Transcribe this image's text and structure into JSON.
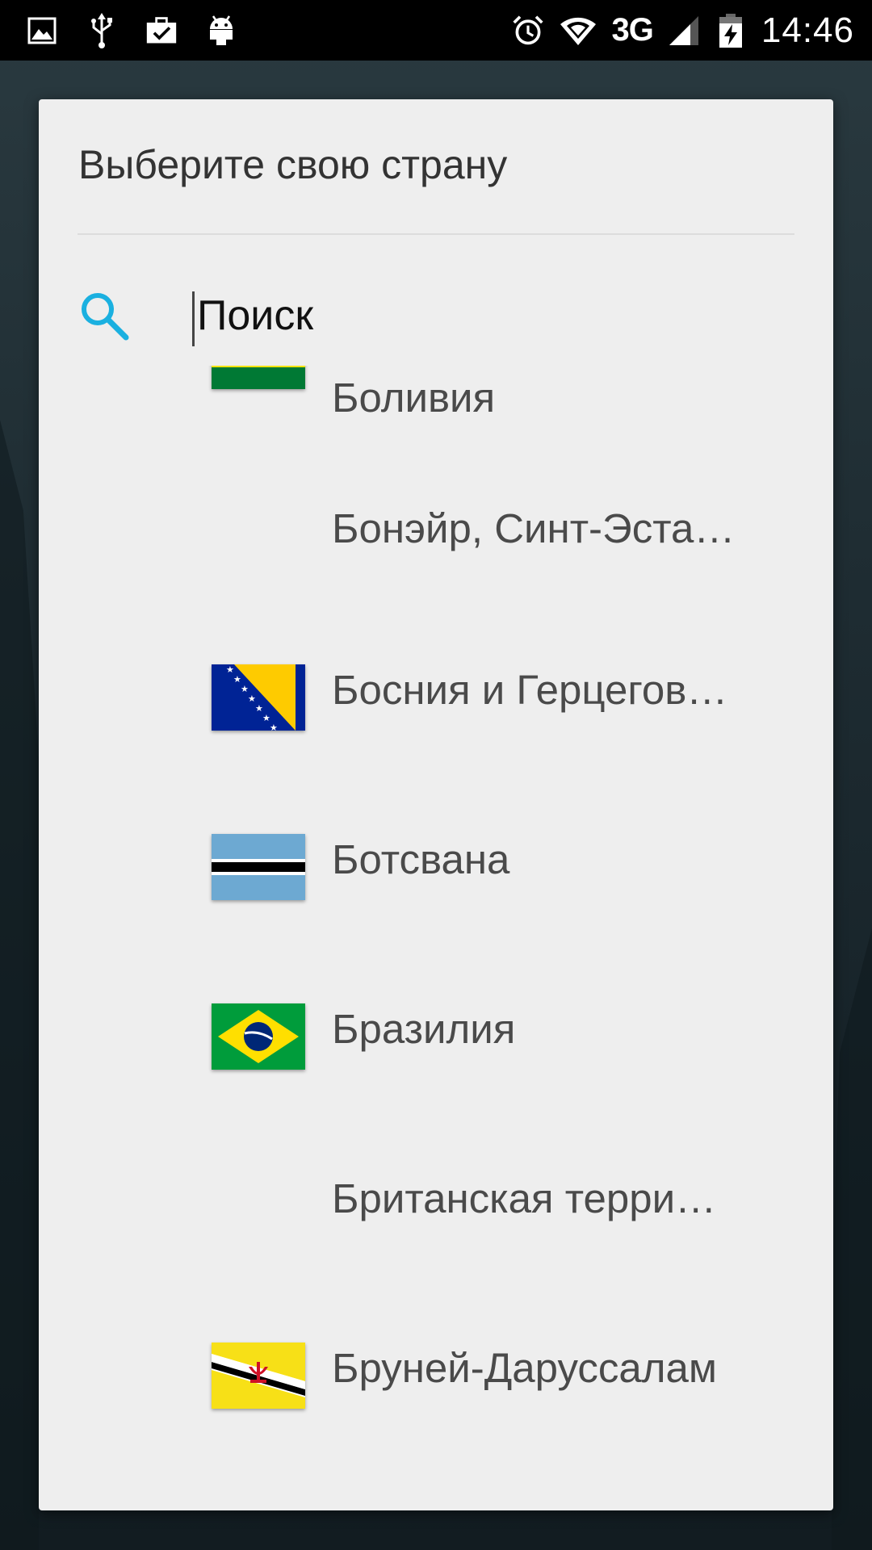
{
  "status_bar": {
    "left_icons": [
      "image-icon",
      "usb-icon",
      "briefcase-check-icon",
      "android-icon"
    ],
    "right_icons": [
      "alarm-icon",
      "wifi-icon"
    ],
    "network": "3G",
    "time": "14:46"
  },
  "dialog": {
    "title": "Выберите свою страну",
    "search": {
      "placeholder": "Поиск",
      "value": ""
    },
    "countries": [
      {
        "name": "Боливия",
        "flag": "bolivia-flag"
      },
      {
        "name": "Бонэйр, Синт-Эста…",
        "flag": ""
      },
      {
        "name": "Босния и Герцегов…",
        "flag": "bosnia-flag"
      },
      {
        "name": "Ботсвана",
        "flag": "botswana-flag"
      },
      {
        "name": "Бразилия",
        "flag": "brazil-flag"
      },
      {
        "name": "Британская терри…",
        "flag": ""
      },
      {
        "name": "Бруней-Даруссалам",
        "flag": "brunei-flag"
      }
    ]
  },
  "colors": {
    "accent": "#1ab0e0",
    "dialog_bg": "#eeeeee",
    "text": "#4a4a4a"
  }
}
